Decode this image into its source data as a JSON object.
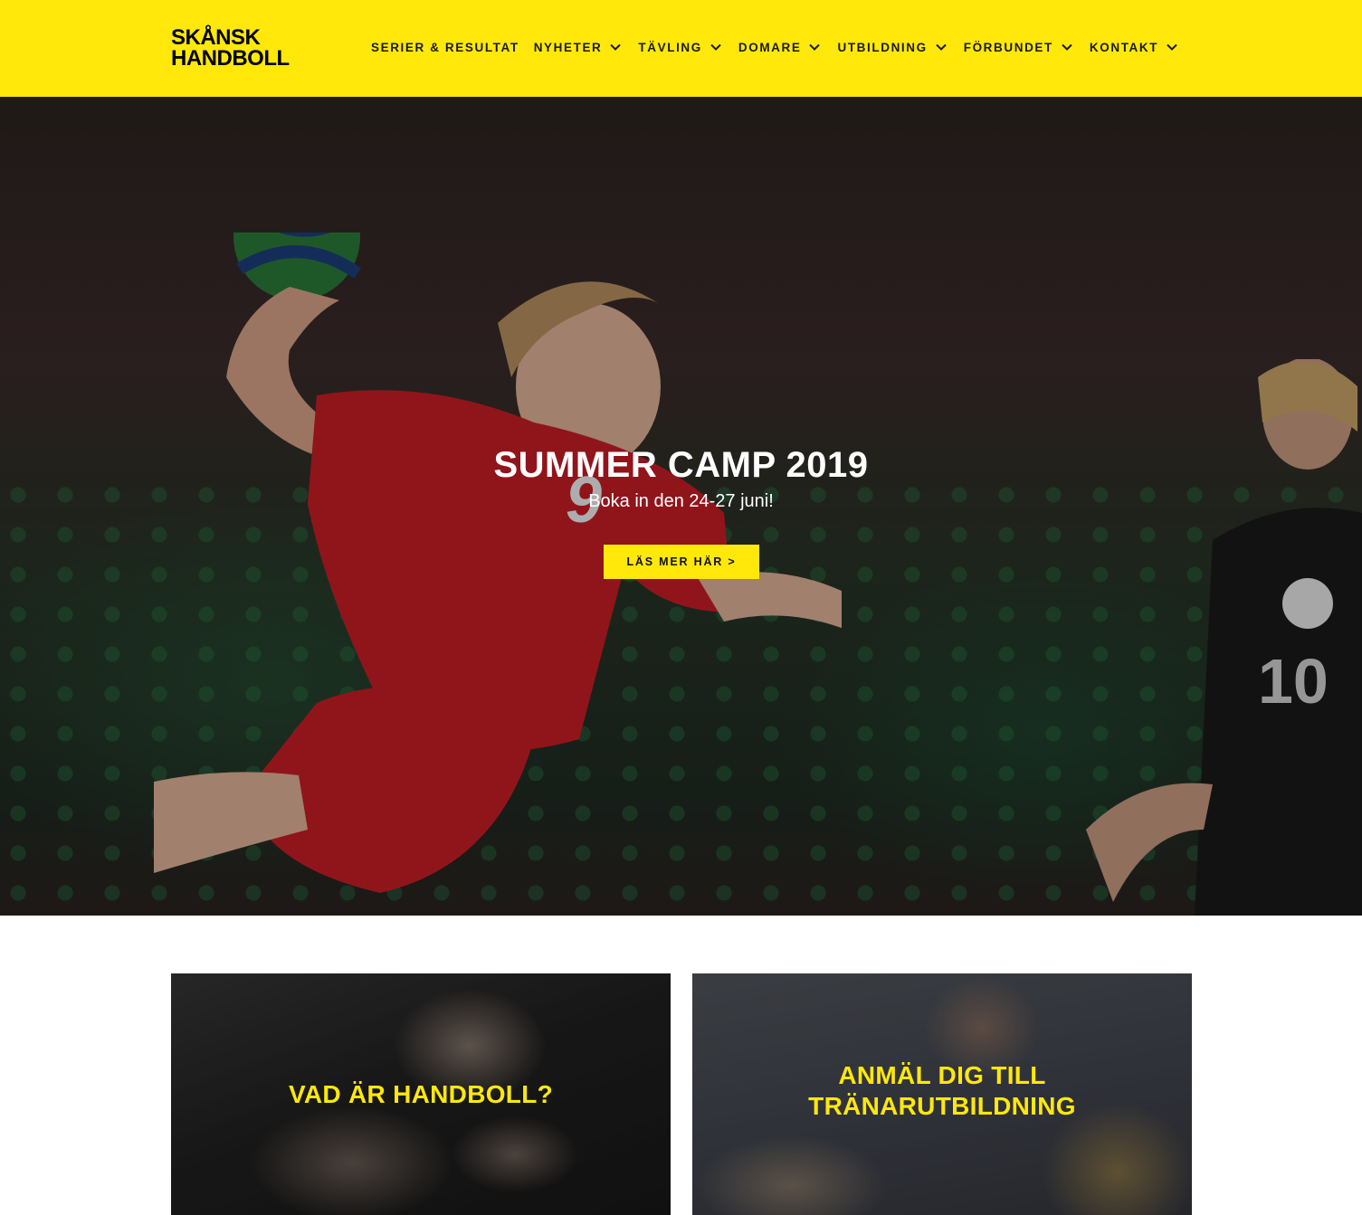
{
  "header": {
    "logo": {
      "line1": "SKÅNSK",
      "line2": "HANDBOLL"
    },
    "background_color": "#ffe80a",
    "nav": [
      {
        "label": "SERIER & RESULTAT",
        "has_dropdown": false,
        "icon": "chevron-down-icon"
      },
      {
        "label": "NYHETER",
        "has_dropdown": true,
        "icon": "chevron-down-icon"
      },
      {
        "label": "TÄVLING",
        "has_dropdown": true,
        "icon": "chevron-down-icon"
      },
      {
        "label": "DOMARE",
        "has_dropdown": true,
        "icon": "chevron-down-icon"
      },
      {
        "label": "UTBILDNING",
        "has_dropdown": true,
        "icon": "chevron-down-icon"
      },
      {
        "label": "FÖRBUNDET",
        "has_dropdown": true,
        "icon": "chevron-down-icon"
      },
      {
        "label": "KONTAKT",
        "has_dropdown": true,
        "icon": "chevron-down-icon"
      }
    ]
  },
  "hero": {
    "title": "SUMMER CAMP 2019",
    "subtitle": "Boka in den 24-27 juni!",
    "button_label": "LÄS MER HÄR >",
    "jersey_number": "9",
    "defender_number": "10"
  },
  "cards": [
    {
      "title": "VAD ÄR HANDBOLL?"
    },
    {
      "title": "ANMÄL DIG TILL TRÄNARUTBILDNING"
    }
  ],
  "colors": {
    "accent": "#ffe80a",
    "hero_text": "#ffffff",
    "card_title": "#ffe80a"
  }
}
